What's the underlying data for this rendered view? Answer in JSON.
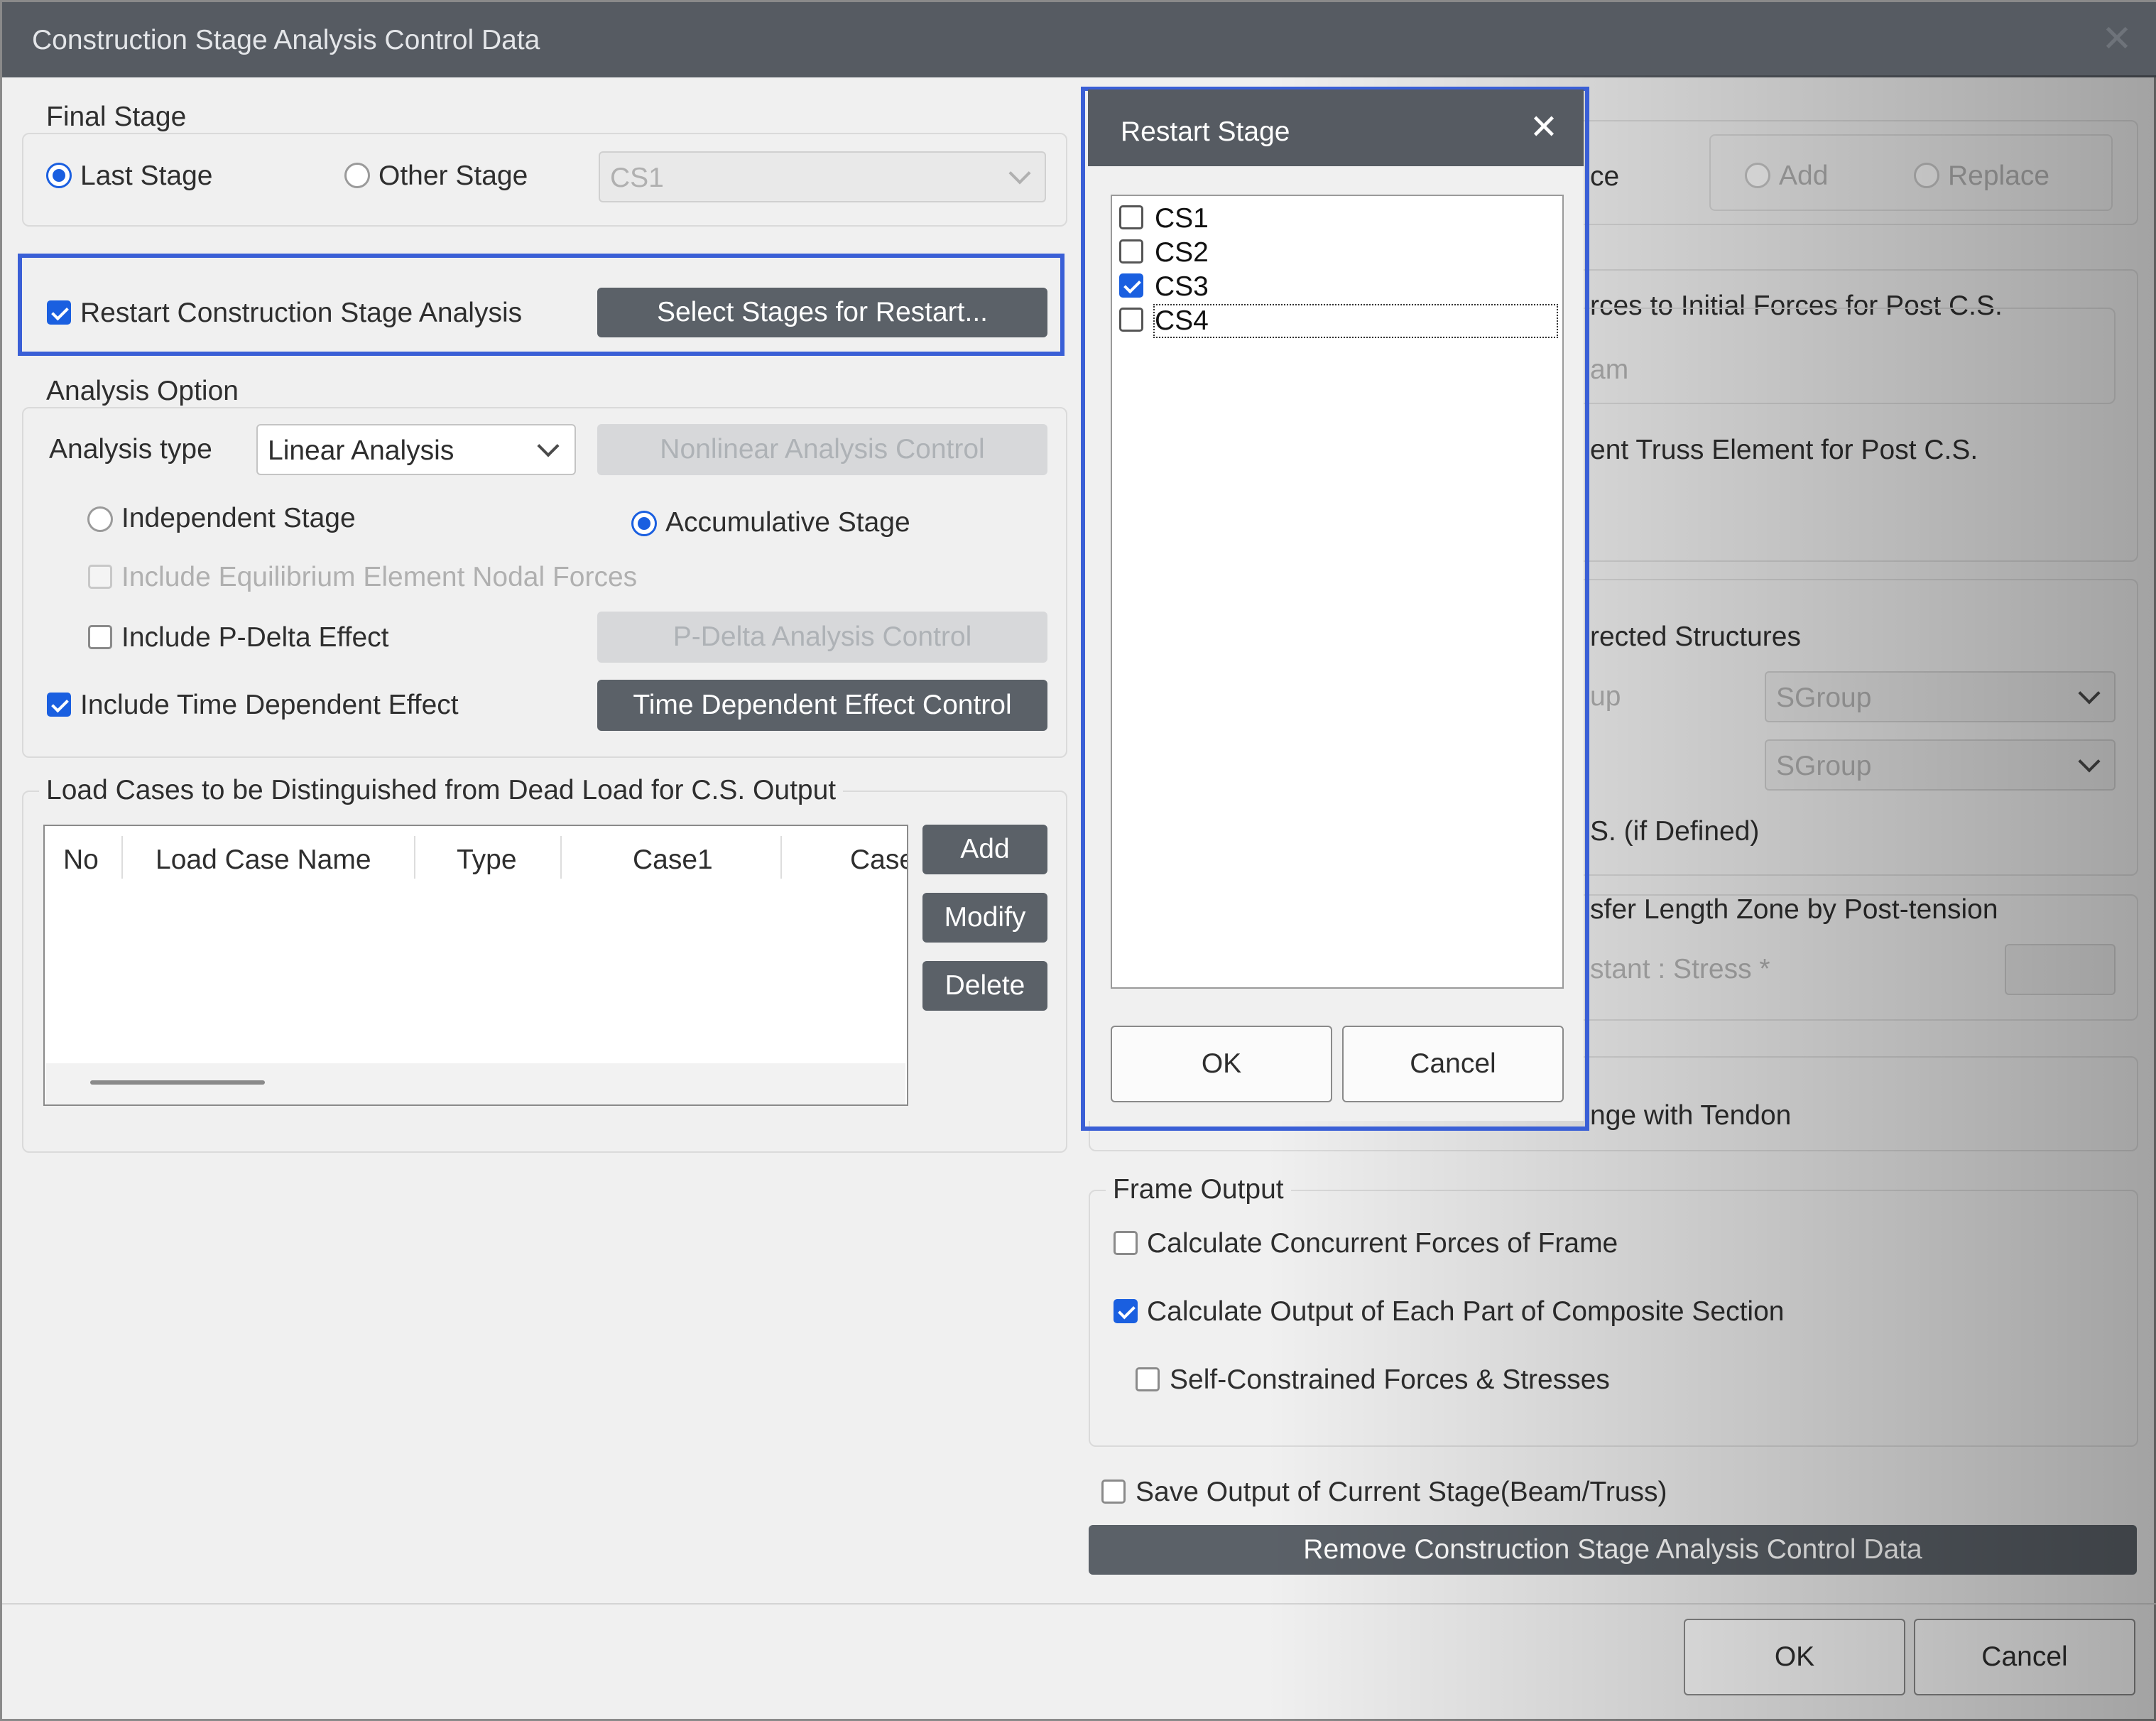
{
  "window": {
    "title": "Construction Stage Analysis Control Data"
  },
  "final_stage": {
    "label": "Final Stage",
    "last_stage": "Last Stage",
    "other_stage": "Other Stage",
    "stage_select": "CS1",
    "selected": "Last Stage"
  },
  "restart": {
    "checkbox_label": "Restart Construction Stage Analysis",
    "checked": true,
    "select_button": "Select Stages for Restart..."
  },
  "analysis_option": {
    "label": "Analysis Option",
    "type_label": "Analysis type",
    "type_value": "Linear Analysis",
    "nonlinear_button": "Nonlinear Analysis Control",
    "independent_stage": "Independent Stage",
    "accumulative_stage": "Accumulative Stage",
    "selected_stage_mode": "Accumulative Stage",
    "equilibrium": "Include Equilibrium Element Nodal Forces",
    "pdelta": "Include P-Delta Effect",
    "pdelta_button": "P-Delta Analysis Control",
    "time_dependent": "Include Time Dependent Effect",
    "time_dependent_button": "Time Dependent Effect Control"
  },
  "load_cases": {
    "label": "Load Cases to be Distinguished from Dead Load for C.S. Output",
    "columns": [
      "No",
      "Load Case Name",
      "Type",
      "Case1",
      "Case"
    ],
    "add": "Add",
    "modify": "Modify",
    "delete": "Delete"
  },
  "right_panel": {
    "ce_fragment": "ce",
    "add_radio": "Add",
    "replace_radio": "Replace",
    "initial_forces": "rces to Initial Forces for Post C.S.",
    "am_fragment": "am",
    "truss": "ent Truss Element for Post C.S.",
    "erected": "rected Structures",
    "up_fragment": "up",
    "sgroup1": "SGroup",
    "sgroup2": "SGroup",
    "if_defined": "S. (if Defined)",
    "transfer": "sfer Length Zone by Post-tension",
    "stant": "stant : Stress *",
    "tendon": "nge with Tendon"
  },
  "frame_output": {
    "label": "Frame Output",
    "concurrent": "Calculate Concurrent Forces of Frame",
    "composite": "Calculate Output of Each Part of Composite Section",
    "self_constrained": "Self-Constrained Forces & Stresses"
  },
  "save_output": "Save Output of Current Stage(Beam/Truss)",
  "remove_button": "Remove Construction Stage Analysis Control Data",
  "footer": {
    "ok": "OK",
    "cancel": "Cancel"
  },
  "restart_popup": {
    "title": "Restart Stage",
    "stages": [
      {
        "name": "CS1",
        "checked": false
      },
      {
        "name": "CS2",
        "checked": false
      },
      {
        "name": "CS3",
        "checked": true
      },
      {
        "name": "CS4",
        "checked": false
      }
    ],
    "ok": "OK",
    "cancel": "Cancel"
  },
  "colors": {
    "accent": "#1a5fe0",
    "titlebar": "#565b62",
    "button": "#5b6168",
    "highlight": "#3a5fd6"
  }
}
